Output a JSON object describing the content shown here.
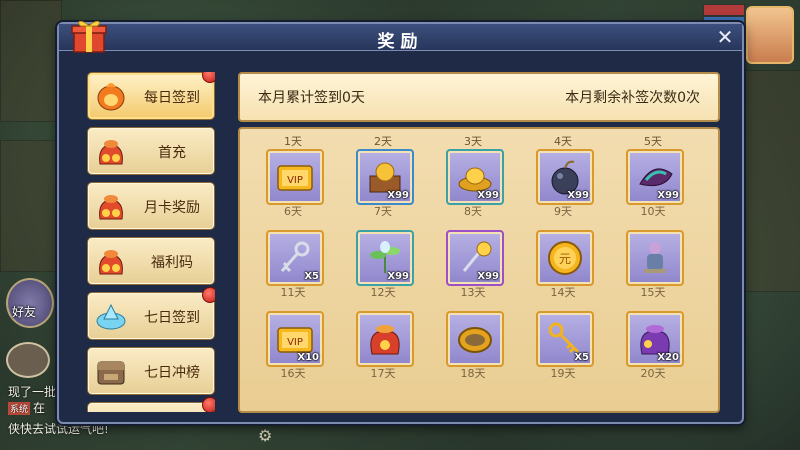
{
  "dialog": {
    "title": "奖励",
    "close_label": "✕"
  },
  "sidebar": {
    "tabs": [
      {
        "label": "每日签到",
        "icon": "fire-egg-icon",
        "active": true,
        "badge": true
      },
      {
        "label": "首充",
        "icon": "treasure-bag-icon",
        "active": false,
        "badge": false
      },
      {
        "label": "月卡奖励",
        "icon": "treasure-bag-icon",
        "active": false,
        "badge": false
      },
      {
        "label": "福利码",
        "icon": "treasure-bag-icon",
        "active": false,
        "badge": false
      },
      {
        "label": "七日签到",
        "icon": "cloud-crystal-icon",
        "active": false,
        "badge": true
      },
      {
        "label": "七日冲榜",
        "icon": "rank-chest-icon",
        "active": false,
        "badge": false
      }
    ]
  },
  "info": {
    "left": "本月累计签到0天",
    "right": "本月剩余补签次数0次"
  },
  "grid": {
    "rows": [
      {
        "top_days": [
          "1天",
          "2天",
          "3天",
          "4天",
          "5天"
        ],
        "items": [
          {
            "icon": "vip-card-icon",
            "qty": "",
            "quality": "orange"
          },
          {
            "icon": "crate-gold-icon",
            "qty": "X99",
            "quality": "blue"
          },
          {
            "icon": "gold-ingot-icon",
            "qty": "X99",
            "quality": "teal"
          },
          {
            "icon": "bomb-icon",
            "qty": "X99",
            "quality": "orange"
          },
          {
            "icon": "purple-shell-icon",
            "qty": "X99",
            "quality": "orange"
          }
        ],
        "bottom_days": [
          "6天",
          "7天",
          "8天",
          "9天",
          "10天"
        ]
      },
      {
        "top_days": [],
        "items": [
          {
            "icon": "silver-key-icon",
            "qty": "X5",
            "quality": "orange"
          },
          {
            "icon": "green-herb-icon",
            "qty": "X99",
            "quality": "teal"
          },
          {
            "icon": "crystal-hammer-icon",
            "qty": "X99",
            "quality": "purple"
          },
          {
            "icon": "gold-coin-icon",
            "qty": "",
            "quality": "orange"
          },
          {
            "icon": "figure-icon",
            "qty": "",
            "quality": "orange"
          }
        ],
        "bottom_days": [
          "11天",
          "12天",
          "13天",
          "14天",
          "15天"
        ]
      },
      {
        "top_days": [],
        "items": [
          {
            "icon": "vip-card-icon",
            "qty": "X10",
            "quality": "orange"
          },
          {
            "icon": "red-bag-icon",
            "qty": "",
            "quality": "orange"
          },
          {
            "icon": "gold-ring-icon",
            "qty": "",
            "quality": "orange"
          },
          {
            "icon": "gold-key-icon",
            "qty": "X5",
            "quality": "orange"
          },
          {
            "icon": "purple-bag-icon",
            "qty": "X20",
            "quality": "orange"
          }
        ],
        "bottom_days": [
          "16天",
          "17天",
          "18天",
          "19天",
          "20天"
        ]
      }
    ]
  },
  "hud": {
    "friend_label": "好友",
    "chat_lines": [
      {
        "tag": "",
        "text": "现了一批"
      },
      {
        "tag": "系统",
        "text": "在"
      },
      {
        "tag": "",
        "text": "侠快去试试运气吧!"
      }
    ]
  }
}
